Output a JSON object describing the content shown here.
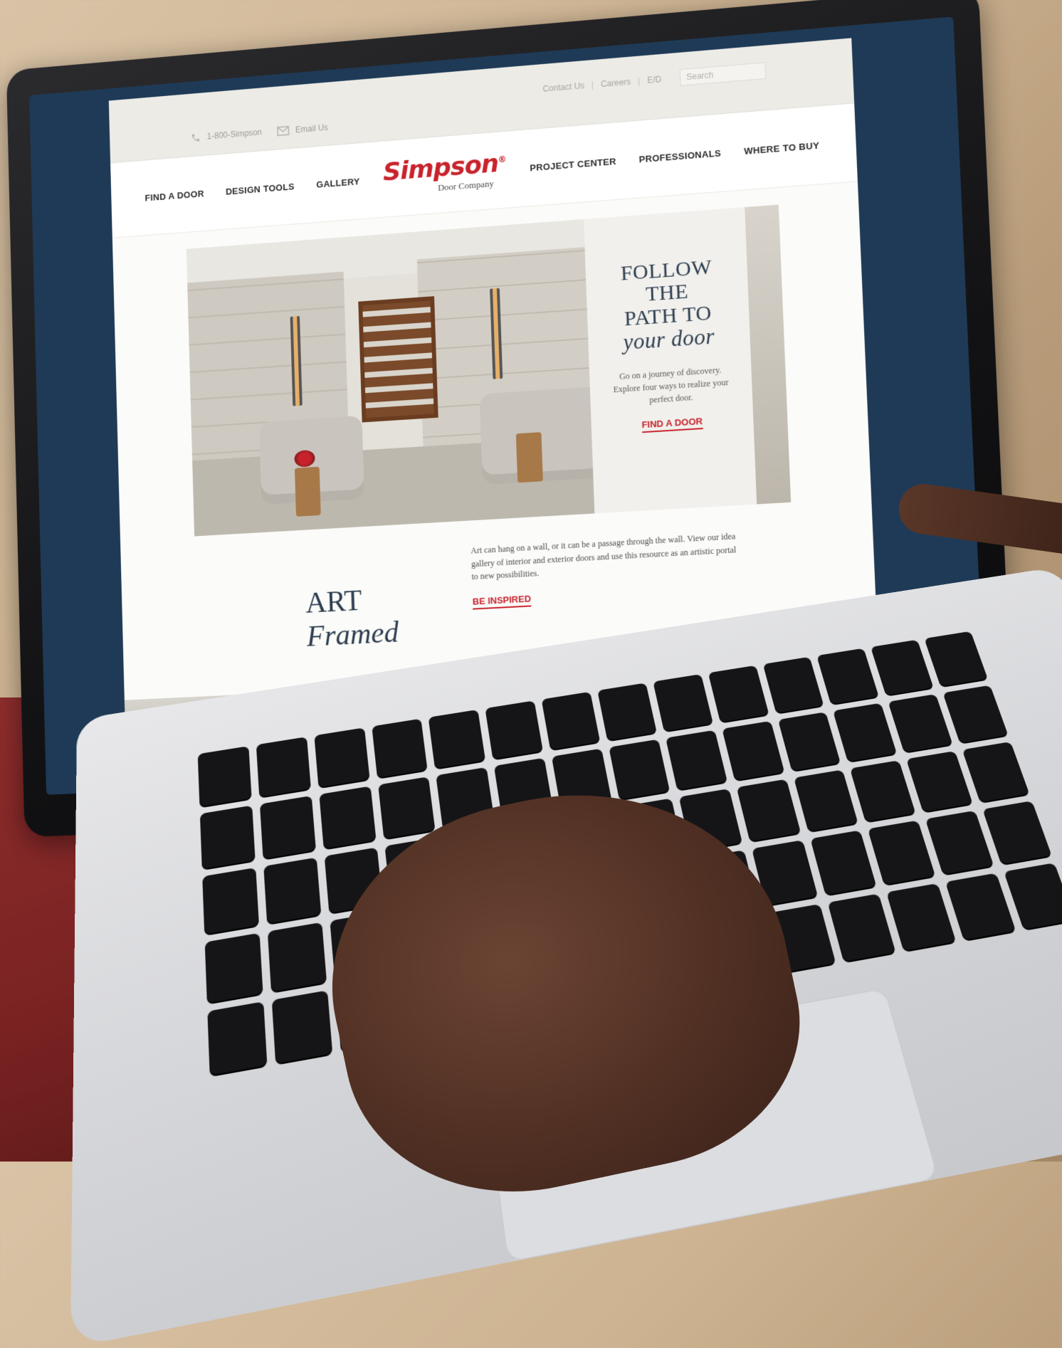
{
  "utility_bar": {
    "phone_label": "1-800-Simpson",
    "email_label": "Email Us",
    "contact_label": "Contact Us",
    "careers_label": "Careers",
    "lang_label": "E/D",
    "search_placeholder": "Search"
  },
  "nav": {
    "left": [
      "FIND A DOOR",
      "DESIGN TOOLS",
      "GALLERY"
    ],
    "right": [
      "PROJECT CENTER",
      "PROFESSIONALS",
      "WHERE TO BUY"
    ]
  },
  "logo": {
    "name": "Simpson",
    "subtitle": "Door Company"
  },
  "hero": {
    "title_line1": "FOLLOW",
    "title_line2": "THE",
    "title_line3": "PATH TO",
    "title_accent": "your door",
    "copy": "Go on a journey of discovery. Explore four ways to realize your perfect door.",
    "cta": "FIND A DOOR"
  },
  "art": {
    "title_word": "ART",
    "title_accent": "Framed",
    "copy": "Art can hang on a wall, or it can be a passage through the wall. View our idea gallery of interior and exterior doors and use this resource as an artistic portal to new possibilities.",
    "cta": "BE INSPIRED"
  },
  "colors": {
    "brand_red": "#c8232c",
    "heading_navy": "#2d3e50",
    "screen_bg": "#1f3a56"
  }
}
